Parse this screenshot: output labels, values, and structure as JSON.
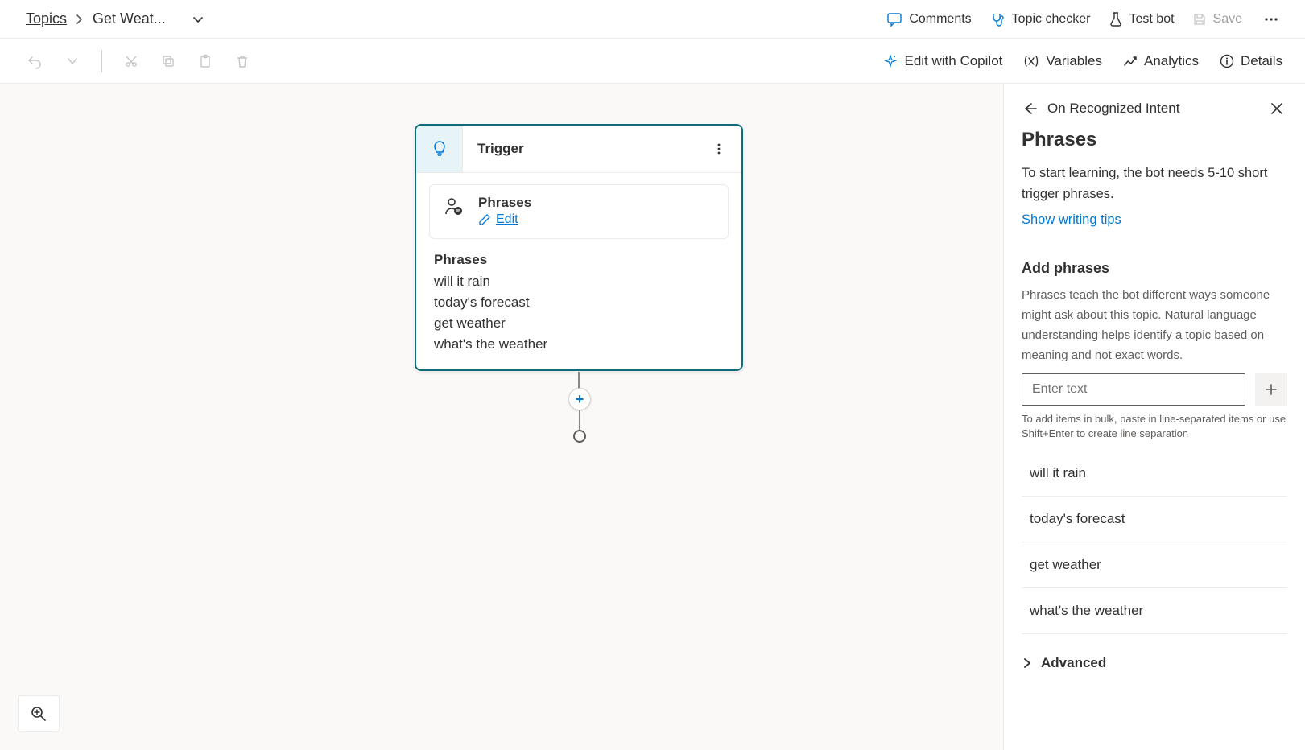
{
  "breadcrumb": {
    "root": "Topics",
    "current": "Get Weat..."
  },
  "topbar": {
    "comments": "Comments",
    "topic_checker": "Topic checker",
    "test_bot": "Test bot",
    "save": "Save"
  },
  "toolbar2": {
    "edit_copilot": "Edit with Copilot",
    "variables": "Variables",
    "analytics": "Analytics",
    "details": "Details"
  },
  "node": {
    "title": "Trigger",
    "card_title": "Phrases",
    "edit_label": "Edit",
    "list_label": "Phrases",
    "phrases": [
      "will it rain",
      "today's forecast",
      "get weather",
      "what's the weather"
    ]
  },
  "panel": {
    "back_title": "On Recognized Intent",
    "heading": "Phrases",
    "intro": "To start learning, the bot needs 5-10 short trigger phrases.",
    "tips_link": "Show writing tips",
    "add_heading": "Add phrases",
    "add_desc": "Phrases teach the bot different ways someone might ask about this topic. Natural language understanding helps identify a topic based on meaning and not exact words.",
    "input_placeholder": "Enter text",
    "hint": "To add items in bulk, paste in line-separated items or use Shift+Enter to create line separation",
    "phrases": [
      "will it rain",
      "today's forecast",
      "get weather",
      "what's the weather"
    ],
    "advanced": "Advanced"
  }
}
